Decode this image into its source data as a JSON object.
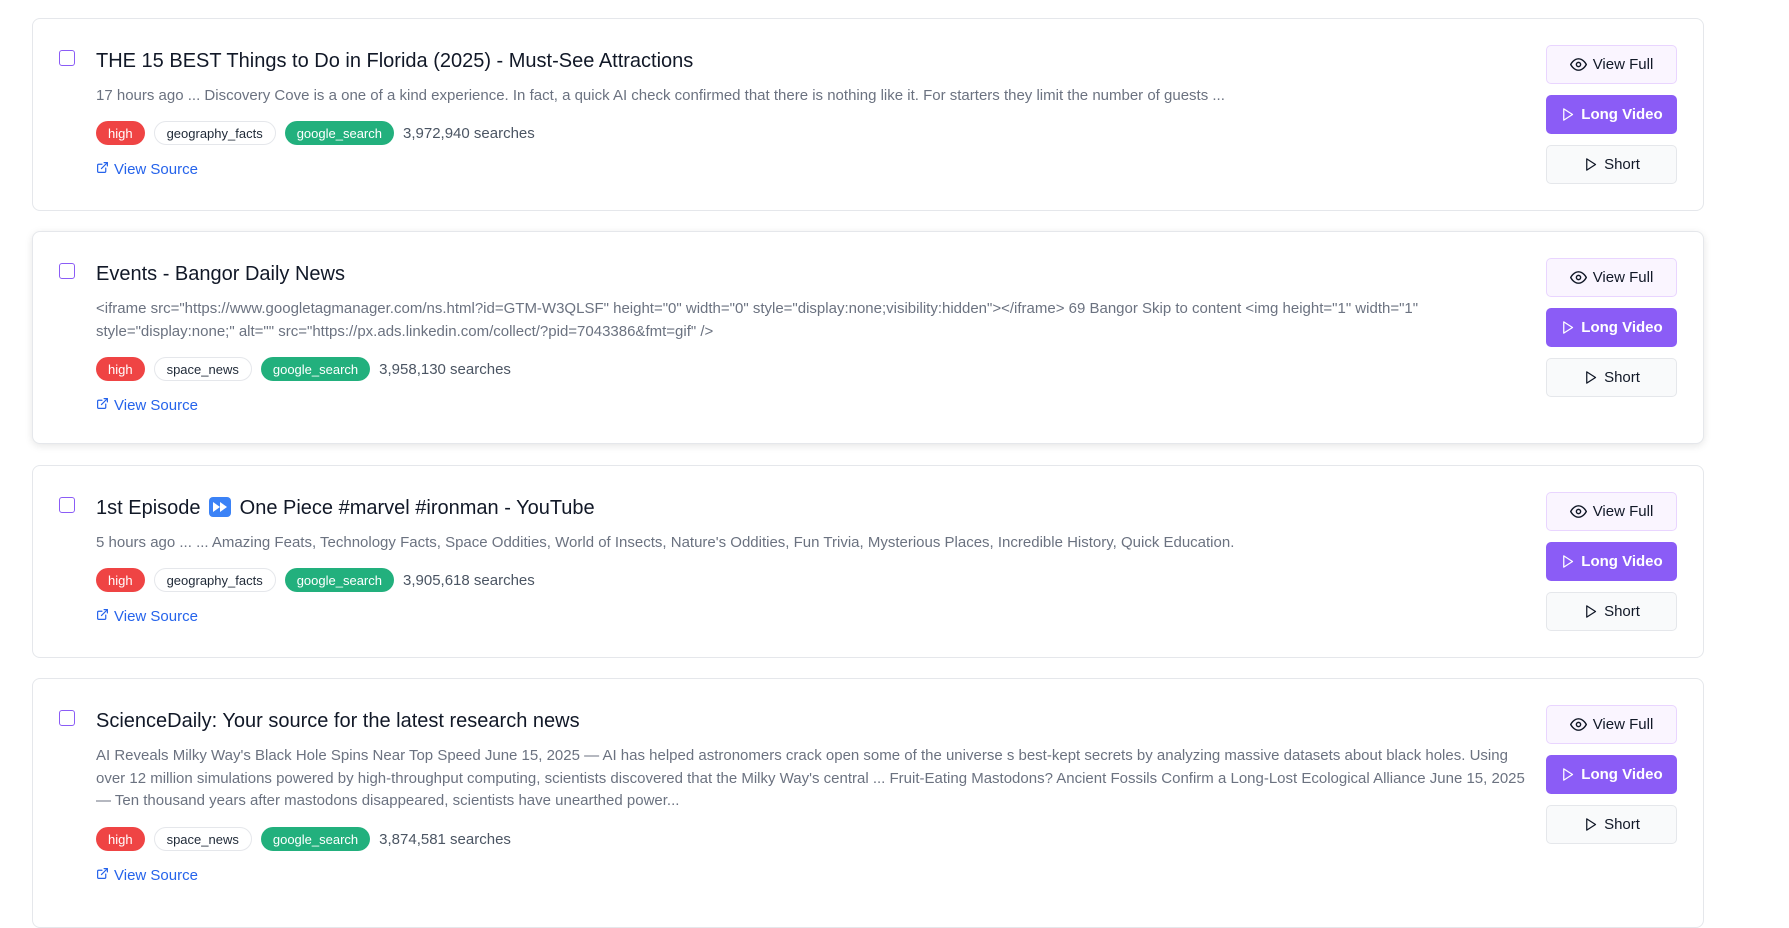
{
  "results": [
    {
      "title": "THE 15 BEST Things to Do in Florida (2025) - Must-See Attractions",
      "snippet": "17 hours ago ... Discovery Cove is a one of a kind experience. In fact, a quick AI check confirmed that there is nothing like it. For starters they limit the number of guests ...",
      "priority": "high",
      "category": "geography_facts",
      "source": "google_search",
      "searches": "3,972,940 searches",
      "link_label": "View Source"
    },
    {
      "title": "Events - Bangor Daily News",
      "snippet": "<iframe src=\"https://www.googletagmanager.com/ns.html?id=GTM-W3QLSF\" height=\"0\" width=\"0\" style=\"display:none;visibility:hidden\"></iframe> 69 Bangor Skip to content <img height=\"1\" width=\"1\" style=\"display:none;\" alt=\"\" src=\"https://px.ads.linkedin.com/collect/?pid=7043386&fmt=gif\" />",
      "priority": "high",
      "category": "space_news",
      "source": "google_search",
      "searches": "3,958,130 searches",
      "link_label": "View Source"
    },
    {
      "title_before": "1st Episode",
      "title_after": "One Piece #marvel #ironman - YouTube",
      "title_icon": "fast-forward-emoji-icon",
      "snippet": "5 hours ago ... ... Amazing Feats, Technology Facts, Space Oddities, World of Insects, Nature's Oddities, Fun Trivia, Mysterious Places, Incredible History, Quick Education.",
      "priority": "high",
      "category": "geography_facts",
      "source": "google_search",
      "searches": "3,905,618 searches",
      "link_label": "View Source"
    },
    {
      "title": "ScienceDaily: Your source for the latest research news",
      "snippet": "AI Reveals Milky Way's Black Hole Spins Near Top Speed June 15, 2025 — AI has helped astronomers crack open some of the universe s best-kept secrets by analyzing massive datasets about black holes. Using over 12 million simulations powered by high-throughput computing, scientists discovered that the Milky Way's central ... Fruit-Eating Mastodons? Ancient Fossils Confirm a Long-Lost Ecological Alliance June 15, 2025 — Ten thousand years after mastodons disappeared, scientists have unearthed power...",
      "priority": "high",
      "category": "space_news",
      "source": "google_search",
      "searches": "3,874,581 searches",
      "link_label": "View Source"
    }
  ],
  "actions": {
    "view_full": "View Full",
    "long_video": "Long Video",
    "short": "Short"
  },
  "colors": {
    "accent": "#8b5cf6",
    "priority_high": "#ef4444",
    "source_badge": "#22b07d",
    "link": "#2563eb"
  }
}
